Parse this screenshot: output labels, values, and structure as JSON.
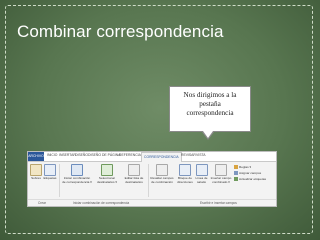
{
  "slide": {
    "title": "Combinar correspondencia",
    "callout": [
      "Nos dirigimos a la",
      "pestaña",
      "correspondencia"
    ]
  },
  "ribbon": {
    "tabs": [
      "ARCHIVO",
      "INICIO",
      "INSERTAR",
      "DISEÑO",
      "DISEÑO DE PÁGINA",
      "REFERENCIAS",
      "CORRESPONDENCIA",
      "REVISAR",
      "VISTA"
    ],
    "active_tab": "CORRESPONDENCIA",
    "buttons": [
      [
        "Sobres",
        ""
      ],
      [
        "Etiquetas",
        ""
      ],
      [
        "Iniciar combinación",
        "de correspondencia ▾"
      ],
      [
        "Seleccionar",
        "destinatarios ▾"
      ],
      [
        "Editar lista de",
        "destinatarios"
      ],
      [
        "Resaltar campos",
        "de combinación"
      ],
      [
        "Bloque de",
        "direcciones"
      ],
      [
        "Línea de",
        "saludo"
      ],
      [
        "Insertar campo",
        "combinado ▾"
      ]
    ],
    "small_buttons": [
      "Reglas ▾",
      "Asignar campos",
      "Actualizar etiquetas"
    ],
    "groups": [
      "Crear",
      "Iniciar combinación de correspondencia",
      "Escribir e insertar campos"
    ]
  },
  "colors": {
    "accent": "#2b579a",
    "background": "#587650"
  }
}
